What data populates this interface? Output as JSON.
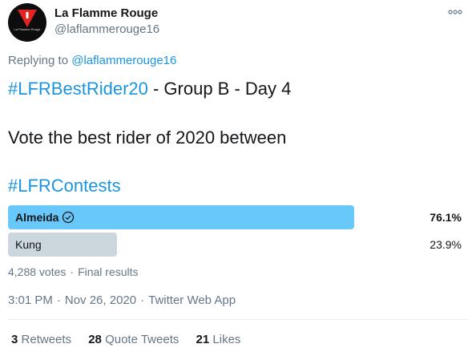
{
  "tweet": {
    "author": {
      "display_name": "La Flamme Rouge",
      "handle": "@laflammerouge16",
      "avatar_text": "La Flamme Rouge",
      "avatar_icon": "flag-logo-icon"
    },
    "more_icon": "more-options-icon",
    "replying": {
      "prefix": "Replying to",
      "handle": "@laflammerouge16"
    },
    "line1": {
      "hashtag": "#LFRBestRider20",
      "rest": " - Group B - Day 4"
    },
    "line2": "Vote the best rider of 2020 between",
    "line3": {
      "hashtag": "#LFRContests"
    }
  },
  "poll": {
    "options": [
      {
        "label": "Almeida",
        "percent_text": "76.1%",
        "share": 0.761,
        "winner": true,
        "icon": "check-circle-icon",
        "bar_color": "#69c8fa"
      },
      {
        "label": "Kung",
        "percent_text": "23.9%",
        "share": 0.239,
        "winner": false,
        "bar_color": "#ccd6dd"
      }
    ],
    "votes": "4,288 votes",
    "separator": "·",
    "status": "Final results"
  },
  "timestamp": {
    "time": "3:01 PM",
    "date": "Nov 26, 2020",
    "source": "Twitter Web App"
  },
  "stats": {
    "retweets_count": "3",
    "retweets_label": "Retweets",
    "quotes_count": "28",
    "quotes_label": "Quote Tweets",
    "likes_count": "21",
    "likes_label": "Likes"
  },
  "colors": {
    "link": "#1b95e0",
    "muted": "#657786",
    "winner_bar": "#69c8fa",
    "other_bar": "#ccd6dd"
  }
}
